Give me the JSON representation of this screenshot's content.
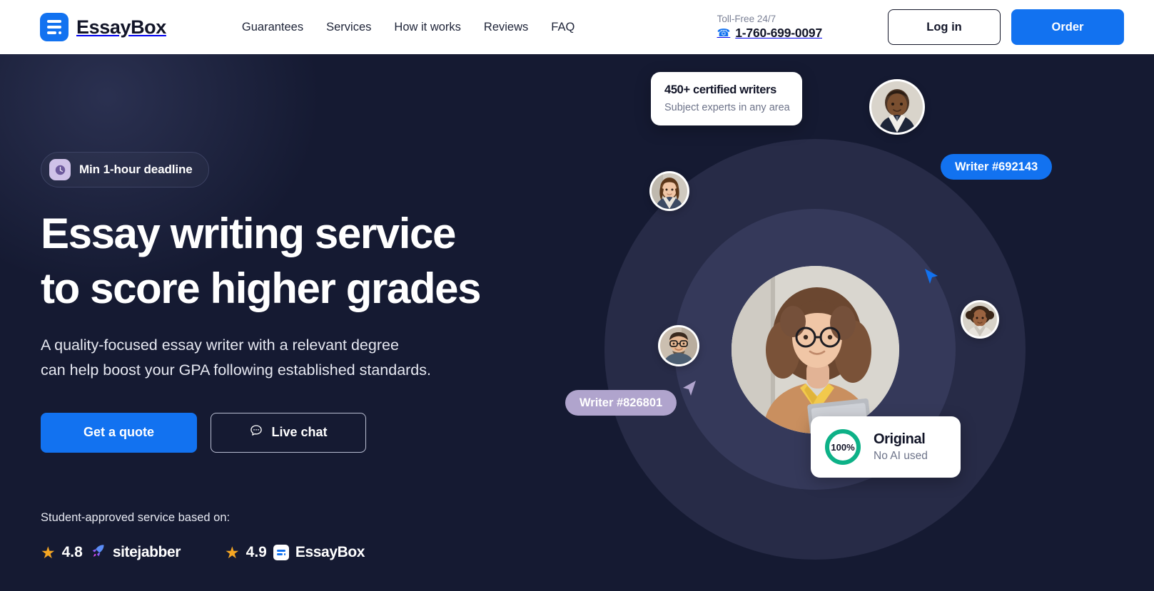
{
  "header": {
    "brand_name": "EssayBox",
    "brand_icon": "document-lines-icon",
    "nav": [
      {
        "label": "Guarantees"
      },
      {
        "label": "Services"
      },
      {
        "label": "How it works"
      },
      {
        "label": "Reviews"
      },
      {
        "label": "FAQ"
      }
    ],
    "phone_label": "Toll-Free 24/7",
    "phone_icon": "phone-icon",
    "phone_number": "1-760-699-0097",
    "login_label": "Log in",
    "order_label": "Order"
  },
  "hero": {
    "badge": {
      "icon": "clock-icon",
      "label": "Min 1-hour deadline"
    },
    "title_line1": "Essay writing service",
    "title_line2": "to score higher grades",
    "subtitle_line1": "A quality-focused essay writer with a relevant degree",
    "subtitle_line2": "can help boost your GPA following established standards.",
    "cta_primary": "Get a quote",
    "cta_secondary": "Live chat",
    "cta_secondary_icon": "chat-bubble-icon",
    "trust_label": "Student-approved service based on:",
    "trust_items": [
      {
        "star_icon": "star-icon",
        "score": "4.8",
        "brand": "sitejabber",
        "brand_icon": "rocket-icon"
      },
      {
        "star_icon": "star-icon",
        "score": "4.9",
        "brand": "EssayBox",
        "brand_icon": "document-lines-icon"
      }
    ]
  },
  "art": {
    "writers_card": {
      "title": "450+ certified writers",
      "subtitle": "Subject experts in any area"
    },
    "pill_blue": "Writer #692143",
    "pill_purple": "Writer #826801",
    "original_card": {
      "percent": "100%",
      "title": "Original",
      "subtitle": "No AI used"
    },
    "avatars": [
      {
        "name": "avatar-writer-1"
      },
      {
        "name": "avatar-writer-2"
      },
      {
        "name": "avatar-writer-3"
      },
      {
        "name": "avatar-writer-4"
      }
    ],
    "center_portrait": "portrait-writer-main"
  },
  "colors": {
    "brand_blue": "#1272f0",
    "page_bg": "#151a32",
    "ring_outer": "#272b47",
    "ring_inner": "#35395a",
    "pill_purple": "#b0a4cd",
    "donut_green": "#0db187",
    "star_gold": "#f5a623"
  }
}
